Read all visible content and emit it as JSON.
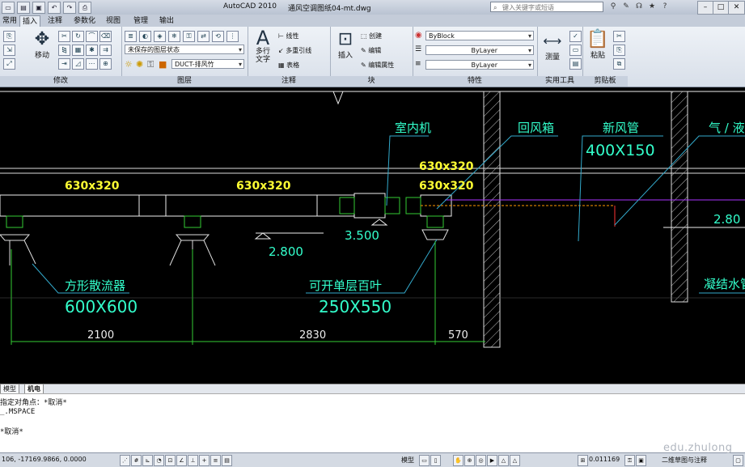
{
  "titlebar": {
    "app_name": "AutoCAD 2010",
    "file_name": "通风空调图纸04-mt.dwg",
    "search_placeholder": "键入关键字或短语",
    "qat_icons": [
      "new-file-icon",
      "open-icon",
      "save-icon",
      "undo-icon",
      "redo-icon",
      "plot-icon"
    ]
  },
  "ribbon_tabs": [
    "常用",
    "插入",
    "注释",
    "参数化",
    "视图",
    "管理",
    "输出"
  ],
  "panels": {
    "modify": {
      "label": "修改",
      "move_label": "移动"
    },
    "layers": {
      "label": "图层",
      "layer_state": "未保存的图层状态",
      "current_layer": "DUCT-排风竹"
    },
    "annotation": {
      "label": "注释",
      "multiline_text_label": "多行\n文字",
      "linear_label": "线性",
      "multileader_label": "多重引线",
      "table_label": "表格"
    },
    "block": {
      "label": "块",
      "insert_label": "插入",
      "create_label": "创建",
      "edit_label": "编辑",
      "edit_attr_label": "编辑属性"
    },
    "properties": {
      "label": "特性",
      "color": "ByBlock",
      "linetype": "ByLayer",
      "lineweight": "ByLayer"
    },
    "utilities": {
      "label": "实用工具",
      "measure_label": "测量"
    },
    "clipboard": {
      "label": "剪贴板",
      "paste_label": "粘贴"
    }
  },
  "drawing": {
    "labels": {
      "indoor_unit": "室内机",
      "return_box": "回风箱",
      "fresh_air_pipe": "新风管",
      "fresh_air_size": "400X150",
      "gas_liquid": "气 / 液",
      "duct_1": "630x320",
      "duct_2": "630x320",
      "duct_3": "630x320",
      "duct_4": "630x320",
      "elev_1": "3.500",
      "elev_2": "2.800",
      "elev_3": "2.80",
      "diffuser": "方形散流器",
      "diffuser_size": "600X600",
      "louver": "可开单层百叶",
      "louver_size": "250X550",
      "condensate": "凝结水管",
      "dim_1": "2100",
      "dim_2": "2830",
      "dim_3": "570"
    }
  },
  "layout_tabs": [
    "模型",
    "机电"
  ],
  "command": {
    "line1": "指定对角点：*取消*",
    "line2": "_.MSPACE",
    "line3": "*取消*"
  },
  "status": {
    "coordinates": "106, -17169.9866, 0.0000",
    "model_label": "模型",
    "scale": "0.011169",
    "workspace": "二维草图与注释"
  },
  "watermark": "edu.zhulong"
}
